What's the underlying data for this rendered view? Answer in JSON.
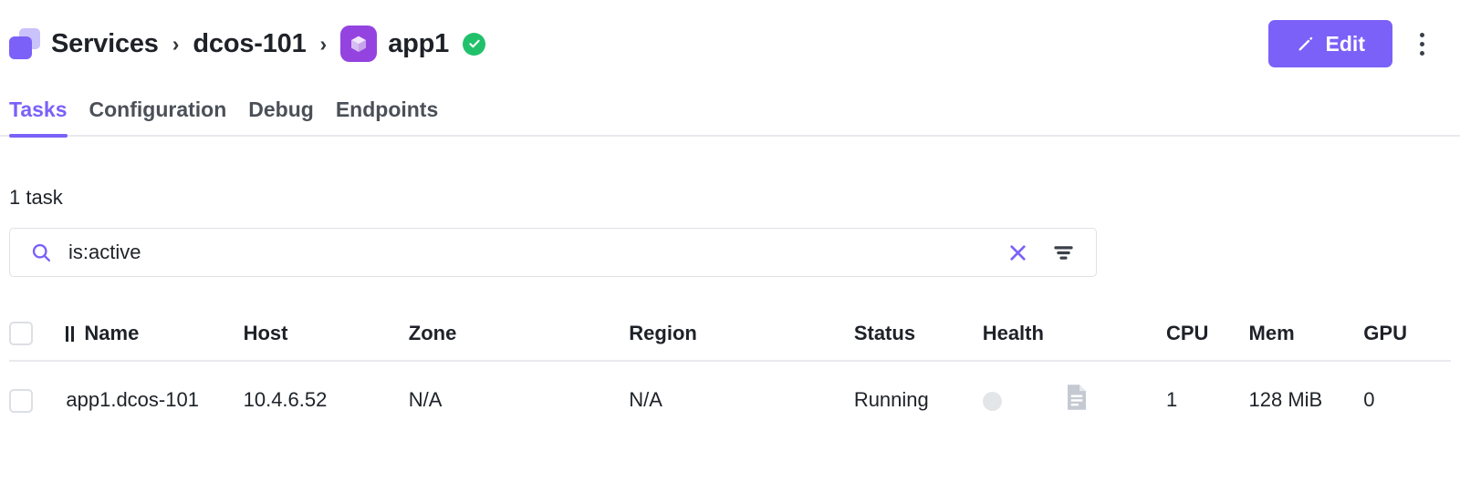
{
  "header": {
    "breadcrumb": [
      {
        "label": "Services",
        "icon": "services-stack-icon"
      },
      {
        "label": "dcos-101",
        "icon": null
      },
      {
        "label": "app1",
        "icon": "app-cube-icon"
      }
    ],
    "separator": "›",
    "app_status_icon": "check-circle-icon",
    "edit_label": "Edit",
    "edit_icon": "pencil-icon",
    "overflow_icon": "kebab-menu-icon",
    "accent_color": "#7b61f8",
    "app_tile_color": "#9443e0",
    "status_color": "#21c16b"
  },
  "tabs": [
    {
      "label": "Tasks",
      "active": true
    },
    {
      "label": "Configuration",
      "active": false
    },
    {
      "label": "Debug",
      "active": false
    },
    {
      "label": "Endpoints",
      "active": false
    }
  ],
  "main": {
    "task_count_label": "1 task",
    "search": {
      "value": "is:active",
      "placeholder": "Search",
      "search_icon": "search-icon",
      "clear_icon": "close-icon",
      "filter_icon": "filter-icon"
    },
    "table": {
      "columns": [
        {
          "key": "select",
          "label": "",
          "align": "left"
        },
        {
          "key": "name",
          "label": "Name",
          "align": "left",
          "icon": "pause-icon"
        },
        {
          "key": "host",
          "label": "Host",
          "align": "left"
        },
        {
          "key": "zone",
          "label": "Zone",
          "align": "left"
        },
        {
          "key": "region",
          "label": "Region",
          "align": "left"
        },
        {
          "key": "status",
          "label": "Status",
          "align": "left"
        },
        {
          "key": "health",
          "label": "Health",
          "align": "left"
        },
        {
          "key": "logs",
          "label": "",
          "align": "center"
        },
        {
          "key": "cpu",
          "label": "CPU",
          "align": "right"
        },
        {
          "key": "mem",
          "label": "Mem",
          "align": "right"
        },
        {
          "key": "gpu",
          "label": "GPU",
          "align": "right"
        }
      ],
      "rows": [
        {
          "name": "app1.dcos-101",
          "host": "10.4.6.52",
          "zone": "N/A",
          "region": "N/A",
          "status": "Running",
          "health_icon": "health-dot-icon",
          "logs_icon": "document-log-icon",
          "cpu": "1",
          "mem": "128 MiB",
          "gpu": "0"
        }
      ]
    }
  }
}
